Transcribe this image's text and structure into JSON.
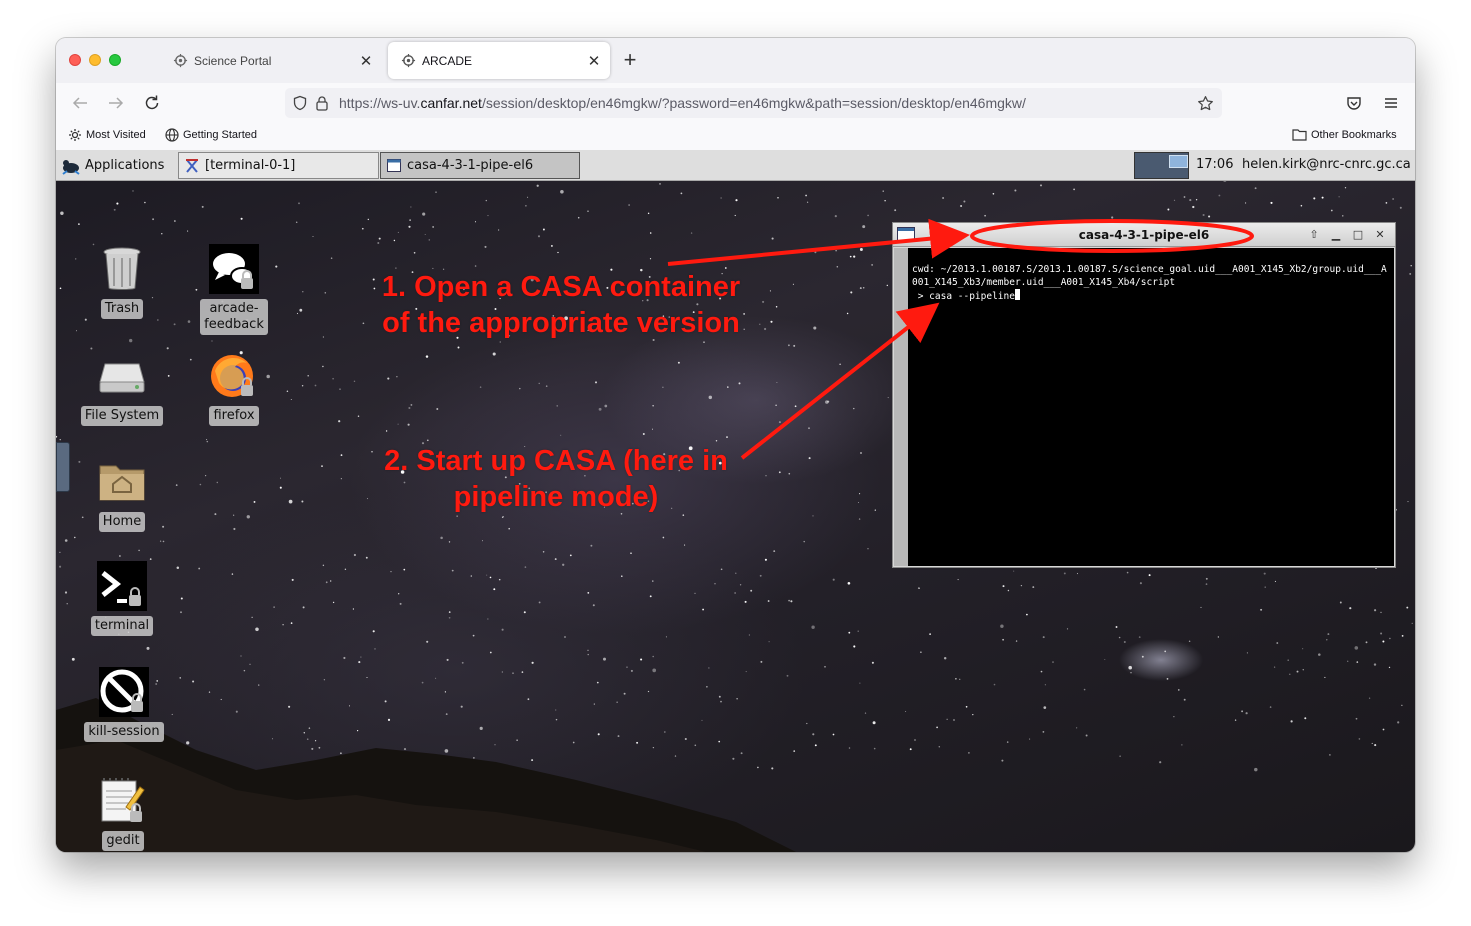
{
  "browser": {
    "tabs": [
      {
        "label": "Science Portal",
        "active": false
      },
      {
        "label": "ARCADE",
        "active": true
      }
    ],
    "url": {
      "prefix": "https://ws-uv.",
      "domain": "canfar.net",
      "path": "/session/desktop/en46mgkw/?password=en46mgkw&path=session/desktop/en46mgkw/"
    },
    "bookmarks": {
      "most_visited": "Most Visited",
      "getting_started": "Getting Started",
      "other": "Other Bookmarks"
    }
  },
  "desktop": {
    "panel": {
      "applications": "Applications",
      "tasks": [
        "[terminal-0-1]",
        "casa-4-3-1-pipe-el6"
      ],
      "clock": "17:06",
      "user": "helen.kirk@nrc-cnrc.gc.ca"
    },
    "icons": {
      "trash": "Trash",
      "arcade_feedback": "arcade-\nfeedback",
      "file_system": "File System",
      "firefox": "firefox",
      "home": "Home",
      "terminal": "terminal",
      "kill_session": "kill-session",
      "gedit": "gedit"
    },
    "terminal_window": {
      "title": "casa-4-3-1-pipe-el6",
      "cwd_line": "cwd: ~/2013.1.00187.S/2013.1.00187.S/science_goal.uid___A001_X145_Xb2/group.uid___A001_X145_Xb3/member.uid___A001_X145_Xb4/script",
      "command_line": " > casa --pipeline"
    }
  },
  "annotations": {
    "step1": "1.  Open a CASA container\nof the appropriate version",
    "step2": "2.  Start up CASA (here in\npipeline mode)",
    "color": "#ff1a0f"
  }
}
